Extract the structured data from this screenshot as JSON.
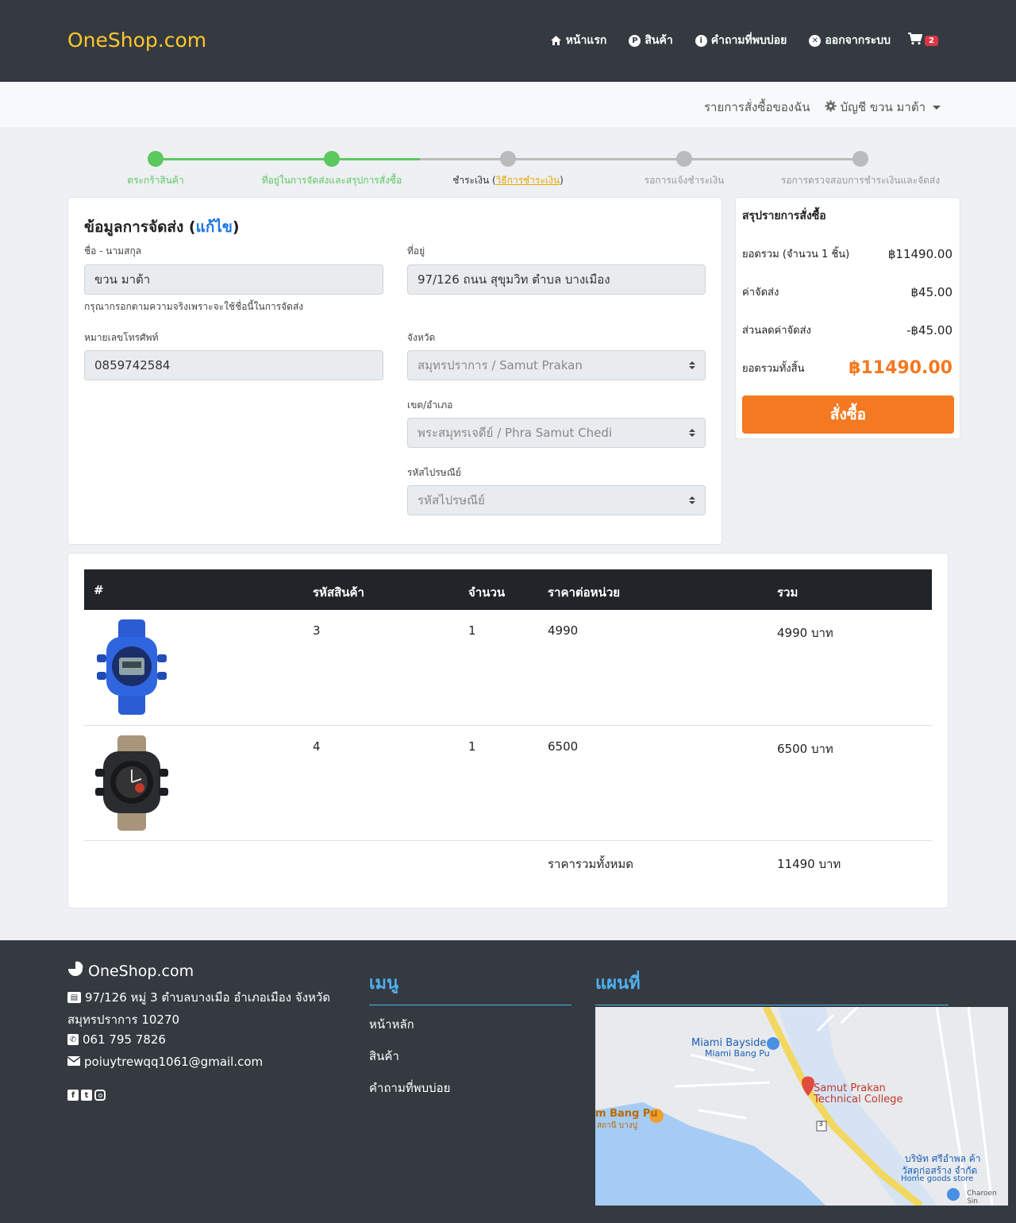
{
  "header": {
    "brand": "OneShop.com",
    "nav": [
      {
        "label": "หน้าแรก",
        "icon": "home-icon"
      },
      {
        "label": "สินค้า",
        "icon": "product-icon"
      },
      {
        "label": "คำถามที่พบบ่อย",
        "icon": "info-icon"
      },
      {
        "label": "ออกจากระบบ",
        "icon": "logout-icon"
      }
    ],
    "cart_count": "2"
  },
  "subbar": {
    "my_orders": "รายการสั่งซื้อของฉัน",
    "account": "บัญชี ขวน มาต้า"
  },
  "stepper": {
    "steps": [
      {
        "label": "ตระกร้าสินค้า",
        "state": "done"
      },
      {
        "label": "ที่อยู่ในการจัดส่งและสรุปการสั่งซื้อ",
        "state": "done"
      },
      {
        "label_prefix": "ชำระเงิน (",
        "label_link": "วิธีการชำระเงิน",
        "label_suffix": ")",
        "state": "current"
      },
      {
        "label": "รอการแจ้งชำระเงิน",
        "state": "todo"
      },
      {
        "label": "รอการตรวจสอบการชำระเงินและจัดส่ง",
        "state": "todo"
      }
    ],
    "colors": {
      "done": "#5cc860",
      "todo": "#bbbbbb"
    }
  },
  "shipping": {
    "title": "ข้อมูลการจัดส่ง (",
    "edit_label": "แก้ไข",
    "title_end": ")",
    "name_label": "ชื่อ - นามสกุล",
    "name_value": "ขวน มาต้า",
    "name_help": "กรุณากรอกตามความจริงเพราะจะใช้ชื่อนี้ในการจัดส่ง",
    "address_label": "ที่อยู่",
    "address_value": "97/126 ถนน สุขุมวิท ตำบล บางเมือง",
    "phone_label": "หมายเลขโทรศัพท์",
    "phone_value": "0859742584",
    "province_label": "จังหวัด",
    "province_value": "สมุทรปราการ / Samut Prakan",
    "district_label": "เขต/อำเภอ",
    "district_value": "พระสมุทรเจดีย์ / Phra Samut Chedi",
    "postal_label": "รหัสไปรษณีย์",
    "postal_value": "รหัสไปรษณีย์"
  },
  "summary": {
    "title": "สรุปรายการสั่งซื้อ",
    "subtotal_label": "ยอดรวม (จำนวน 1 ชิ้น)",
    "subtotal_value": "฿11490.00",
    "shipping_label": "ค่าจัดส่ง",
    "shipping_value": "฿45.00",
    "discount_label": "ส่วนลดค่าจัดส่ง",
    "discount_value": "-฿45.00",
    "total_label": "ยอดรวมทั้งสิ้น",
    "total_value": "฿11490.00",
    "order_button": "สั่งซื้อ",
    "accent": "#f47920"
  },
  "table": {
    "headers": [
      "#",
      "รหัสสินค้า",
      "จำนวน",
      "ราคาต่อหน่วย",
      "รวม"
    ],
    "rows": [
      {
        "code": "3",
        "qty": "1",
        "unit_price": "4990",
        "total": "4990 บาท",
        "image": "blue-watch-image"
      },
      {
        "code": "4",
        "qty": "1",
        "unit_price": "6500",
        "total": "6500 บาท",
        "image": "khaki-watch-image"
      }
    ],
    "grand_label": "ราคารวมทั้งหมด",
    "grand_value": "11490 บาท"
  },
  "footer": {
    "brand": "OneShop.com",
    "address_line1": "97/126 หมู่ 3 ตำบลบางเมือ อำเภอเมือง จังหวัด",
    "address_line2": "สมุทรปราการ 10270",
    "phone": "061 795 7826",
    "email": "poiuytrewqq1061@gmail.com",
    "menu_title": "เมนู",
    "menu_items": [
      "หน้าหลัก",
      "สินค้า",
      "คำถามที่พบบ่อย"
    ],
    "map_title": "แผนที่",
    "map_labels": {
      "bayside": "Miami Bayside",
      "bayside_sub": "Miami Bang Pu",
      "college1": "Samut Prakan",
      "college2": "Technical College",
      "bangpu": "m Bang Pu",
      "bangpu_th": "สถานี บางปู",
      "company1": "บริษัท ศรีอำพล ค้า",
      "company2": "วัสดุก่อสร้าง จำกัด",
      "home": "Home goods store",
      "charoen": "Charoen Sin",
      "road": "3"
    },
    "link_color": "#4fb0f0"
  }
}
